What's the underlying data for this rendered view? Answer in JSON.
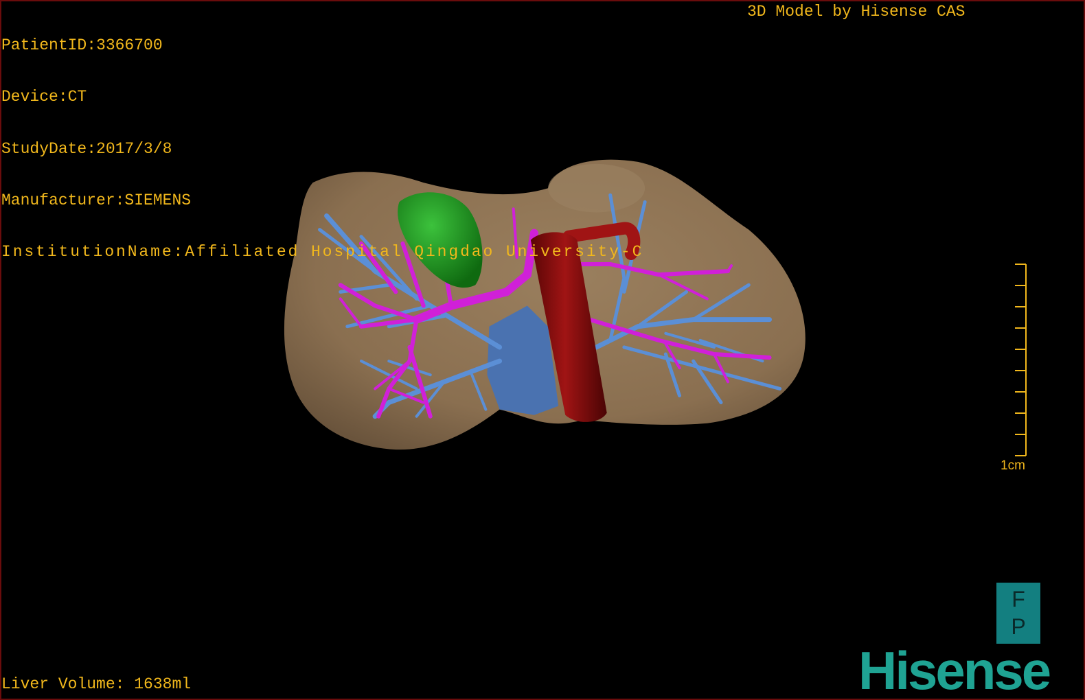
{
  "header": {
    "patient_id": "PatientID:3366700",
    "device": "Device:CT",
    "study_date": "StudyDate:2017/3/8",
    "manufacturer": "Manufacturer:SIEMENS",
    "institution": "InstitutionName:Affiliated Hospital Qingdao University-C",
    "title": "3D Model by Hisense CAS"
  },
  "footer": {
    "liver_volume": "Liver Volume: 1638ml"
  },
  "scale_bar": {
    "label": "1cm"
  },
  "orientation": {
    "top": "F",
    "bottom": "P"
  },
  "logo": "Hisense",
  "colors": {
    "text": "#f2b81c",
    "liver": "#8c7253",
    "portal_vein": "#d020d8",
    "hepatic_vein": "#5b8fd6",
    "aorta": "#8a0c0c",
    "gallbladder": "#1f9a1f",
    "ivc": "#4a72b0",
    "logo": "#1fa393"
  }
}
